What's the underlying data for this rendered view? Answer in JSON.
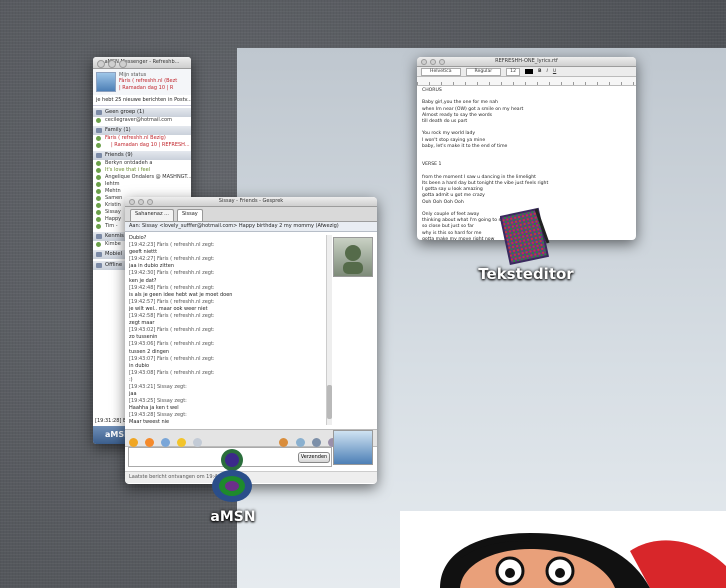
{
  "msn_window": {
    "title": "aMSN Messenger - Refreshb...",
    "status_title": "Mijn status",
    "status_name": "Fàris ( refreshh.nl (Bezt",
    "status_sub": "| Ramadan dag 10 | R",
    "email_line": "je hebt 25 nieuwe berichten in Postv...",
    "groups": [
      {
        "label": "Geen groep (1)",
        "contacts": [
          "cecilegraver@hotmail.com"
        ]
      },
      {
        "label": "Family (1)",
        "contacts": [
          "Fàris ( refreshh.nl  Bezig)",
          "| Ramadan dag 10 | REFRESH..."
        ]
      },
      {
        "label": "Friends (9)",
        "contacts": [
          "Berkyn  ontdadeh  a",
          "It's love that i feel",
          "Angelique Ondalers @ MASHNGT...",
          "Iehtm",
          "Mehtn",
          "Samen",
          "Kristin",
          "Sissay",
          "Happy",
          "Tim -"
        ]
      },
      {
        "label": "Kenmis",
        "contacts": [
          "Kimbe"
        ]
      },
      {
        "label": "Mobiel",
        "contacts": []
      },
      {
        "label": "Offline",
        "contacts": []
      }
    ],
    "footer_time": "[19:31:28] Eo",
    "footer_brand": "aMSN"
  },
  "chat_window": {
    "title": "Sissay - Friends - Gesprek",
    "tabs": [
      "Sahanenaz ...",
      "Sissay"
    ],
    "to_label": "Aan:",
    "to_value": "Sissay <lovely_sufffer@hotmail.com> Happy birthday 2 my mommy  (Afwezig)",
    "lines": [
      {
        "meta": false,
        "text": "Dubio?"
      },
      {
        "meta": true,
        "text": "[19:42:23] Fàris ( refreshh.nl  zegt:"
      },
      {
        "meta": false,
        "text": "geeft niettt"
      },
      {
        "meta": true,
        "text": "[19:42:27] Fàris ( refreshh.nl  zegt:"
      },
      {
        "meta": false,
        "text": "jaa in dubio zitten"
      },
      {
        "meta": true,
        "text": "[19:42:30] Fàris ( refreshh.nl  zegt:"
      },
      {
        "meta": false,
        "text": "ken je dat?"
      },
      {
        "meta": true,
        "text": "[19:42:48] Fàris ( refreshh.nl  zegt:"
      },
      {
        "meta": false,
        "text": "is als je geen idee hebt wat je moet doen"
      },
      {
        "meta": true,
        "text": "[19:42:57] Fàris ( refreshh.nl  zegt:"
      },
      {
        "meta": false,
        "text": "je wilt wel.. maar ook weer niet"
      },
      {
        "meta": true,
        "text": "[19:42:58] Fàris ( refreshh.nl  zegt:"
      },
      {
        "meta": false,
        "text": "zegt maar"
      },
      {
        "meta": true,
        "text": "[19:43:02] Fàris ( refreshh.nl  zegt:"
      },
      {
        "meta": false,
        "text": "zo tussenin"
      },
      {
        "meta": true,
        "text": "[19:43:06] Fàris ( refreshh.nl  zegt:"
      },
      {
        "meta": false,
        "text": "tussen 2 dingen"
      },
      {
        "meta": true,
        "text": "[19:43:07] Fàris ( refreshh.nl  zegt:"
      },
      {
        "meta": false,
        "text": "in dubio"
      },
      {
        "meta": true,
        "text": "[19:43:08] Fàris ( refreshh.nl  zegt:"
      },
      {
        "meta": false,
        "text": ":)"
      },
      {
        "meta": true,
        "text": "[19:43:21] Sissay zegt:"
      },
      {
        "meta": false,
        "text": "jaa"
      },
      {
        "meta": true,
        "text": "[19:43:25] Sissay zegt:"
      },
      {
        "meta": false,
        "text": "Haahha ja ken t wel"
      },
      {
        "meta": true,
        "text": "[19:43:28] Sissay zegt:"
      },
      {
        "meta": false,
        "text": "Maar tweest nie"
      },
      {
        "meta": true,
        "text": "[19:43:31] Sissay zegt:"
      },
      {
        "meta": false,
        "text": "Op moment mise"
      },
      {
        "meta": true,
        "text": "[19:43:52] Sissay zegt:"
      },
      {
        "meta": false,
        "text": "Hahaha"
      }
    ],
    "send_label": "Verzenden",
    "status_bar": "Laatste bericht ontvangen om 19:4..."
  },
  "editor_window": {
    "title": "REFRESHH-ONE_lyrics.rtf",
    "toolbar_font": "Helvetica",
    "toolbar_style": "Regular",
    "toolbar_size": "12",
    "lines": [
      "CHORUS",
      "",
      "Baby girl,you the one for me nah",
      "when Im near (OW) got a smile on my heart",
      "Almost ready to say the words",
      "till death do us part",
      "",
      "You rock my world lady",
      "I won't stop saying ya mine",
      "baby, let's make it to the end of time",
      "",
      "",
      "VERSE 1",
      "",
      "from the moment I saw u dancing in the limelight",
      "Its been a hard day but tonight the vibe just feels right",
      "I gotta say u look amazing",
      "gotta admit u got me crazy",
      "Ooh Ooh Ooh Ooh",
      "",
      "Only couple of feet away",
      "thinking about what I'm going to say",
      "so close but just so far",
      "why is this so hard for me",
      "gotta make my move right now",
      "before this moment will be a memory"
    ]
  },
  "desktop": {
    "icons": [
      {
        "label": "Teksteditor",
        "name": "teksteditor-icon"
      },
      {
        "label": "aMSN",
        "name": "amsn-icon"
      }
    ]
  },
  "colors": {
    "accent_red": "#c0232a",
    "desktop_bg": "#55585d"
  }
}
